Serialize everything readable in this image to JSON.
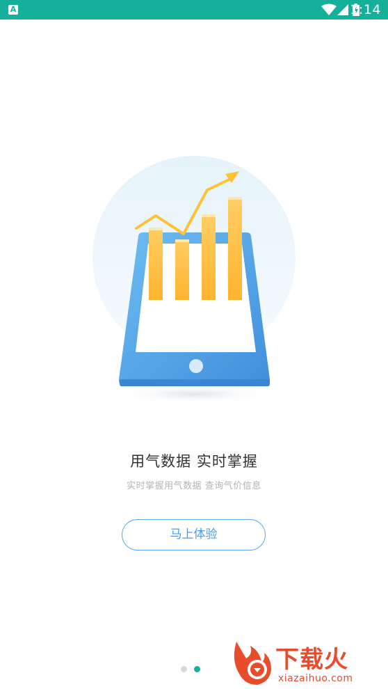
{
  "status_bar": {
    "time": "1:14",
    "app_badge": "A",
    "colors": {
      "background": "#14b09a",
      "foreground": "#ffffff"
    },
    "icons": [
      "wifi-icon",
      "cellular-signal-icon",
      "battery-charging-icon"
    ]
  },
  "onboarding": {
    "headline": "用气数据  实时掌握",
    "subline": "实时掌握用气数据  查询气价信息",
    "cta_label": "马上体验",
    "accent_color": "#4a9be3",
    "page_indicator": {
      "total": 2,
      "active": 2
    }
  },
  "watermark": {
    "title": "下载火",
    "url": "xiazaihuo.com"
  }
}
